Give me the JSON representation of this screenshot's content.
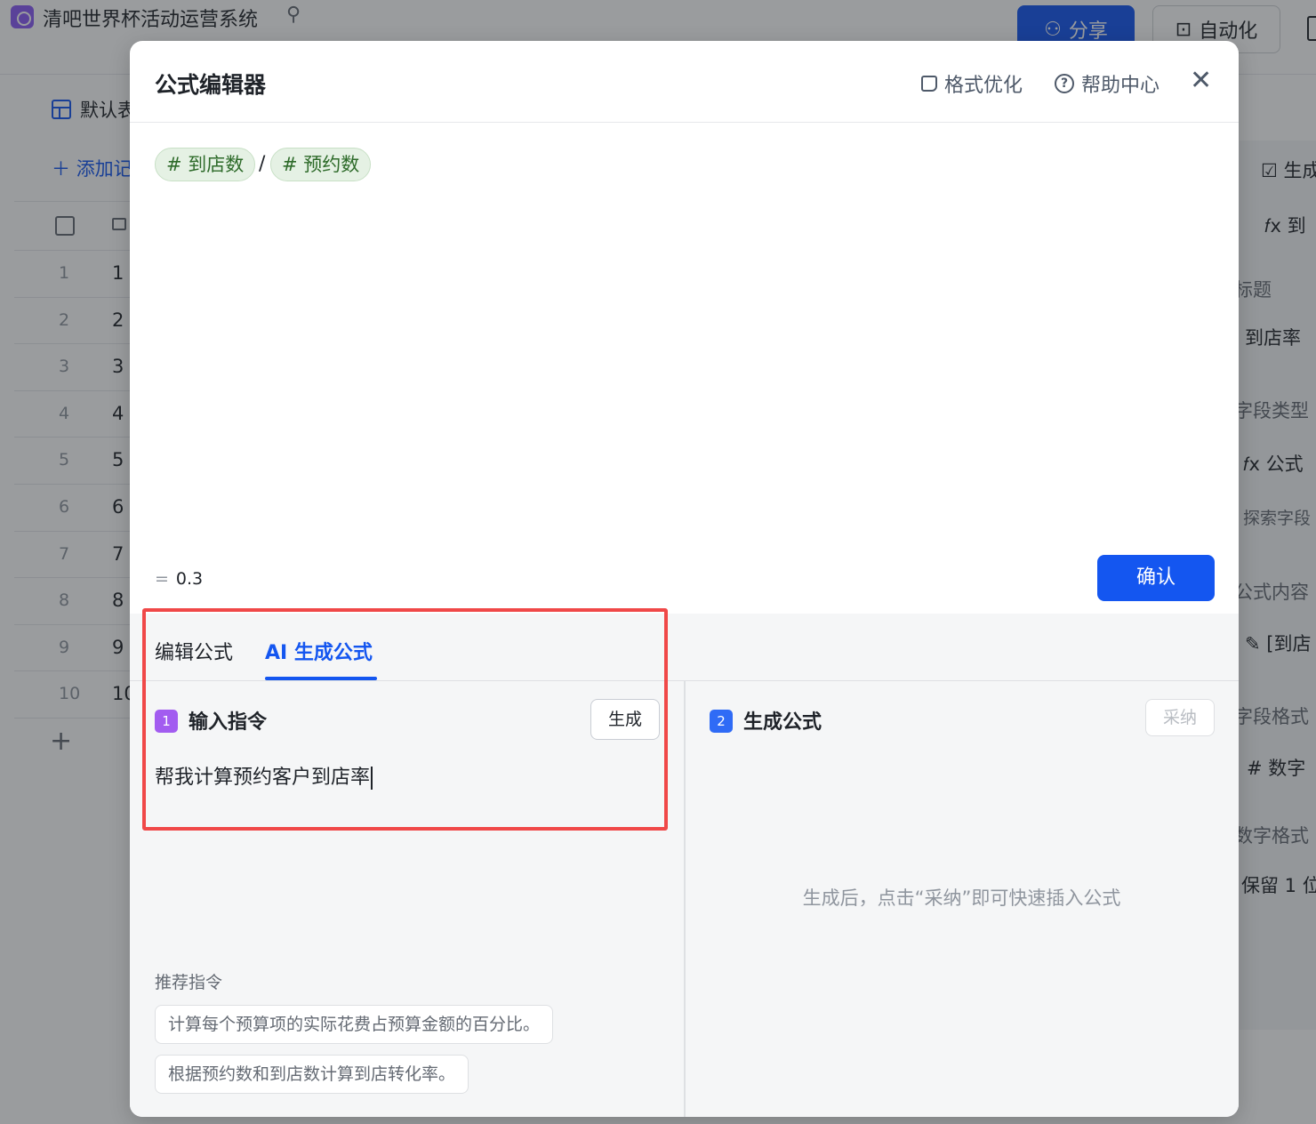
{
  "app": {
    "title": "清吧世界杯活动运营系统",
    "share_label": "分享",
    "automation_label": "自动化",
    "view_tab_label": "默认表",
    "add_record_label": "添加记录",
    "rows": [
      {
        "index": "1",
        "value": "1"
      },
      {
        "index": "2",
        "value": "2"
      },
      {
        "index": "3",
        "value": "3"
      },
      {
        "index": "4",
        "value": "4"
      },
      {
        "index": "5",
        "value": "5"
      },
      {
        "index": "6",
        "value": "6"
      },
      {
        "index": "7",
        "value": "7"
      },
      {
        "index": "8",
        "value": "8"
      },
      {
        "index": "9",
        "value": "9"
      },
      {
        "index": "10",
        "value": "10"
      }
    ]
  },
  "side_panel": {
    "generate_label": "生成",
    "formula_top": "到",
    "title_label": "标题",
    "title_value": "到店率",
    "field_type_label": "字段类型",
    "field_type_value": "公式",
    "explore_label": "探索字段",
    "formula_content_label": "公式内容",
    "formula_content_value": "[到店",
    "field_format_label": "字段格式",
    "field_format_value": "数字",
    "number_format_label": "数字格式",
    "number_format_value": "保留 1 位"
  },
  "modal": {
    "title": "公式编辑器",
    "format_optimize_label": "格式优化",
    "help_center_label": "帮助中心",
    "formula": {
      "field_1": "# 到店数",
      "operator": "/",
      "field_2": "# 预约数"
    },
    "result_value": "0.3",
    "confirm_label": "确认",
    "tabs": [
      {
        "label": "编辑公式",
        "active": false
      },
      {
        "label": "AI 生成公式",
        "active": true
      }
    ],
    "step1": {
      "number": "1",
      "title": "输入指令",
      "generate_label": "生成",
      "instruction_text": "帮我计算预约客户到店率"
    },
    "recommend": {
      "label": "推荐指令",
      "items": [
        "计算每个预算项的实际花费占预算金额的百分比。",
        "根据预约数和到店数计算到店转化率。"
      ]
    },
    "step2": {
      "number": "2",
      "title": "生成公式",
      "adopt_label": "采纳",
      "hint": "生成后，点击“采纳”即可快速插入公式"
    }
  },
  "colors": {
    "accent": "#1456f0",
    "highlight": "#f04848",
    "chip_bg": "#e5f1e4",
    "step1_badge": "#a25cf0",
    "step2_badge": "#2f6bf6"
  }
}
